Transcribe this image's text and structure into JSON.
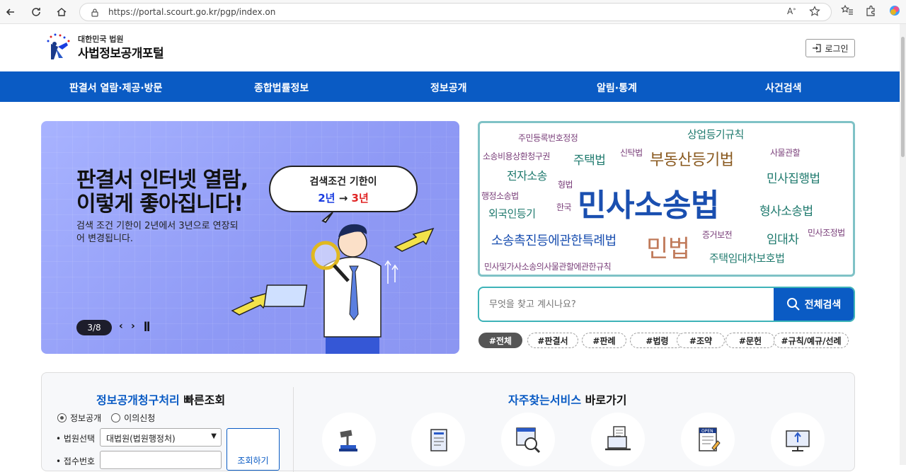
{
  "browser": {
    "url": "https://portal.scourt.go.kr/pgp/index.on"
  },
  "header": {
    "logo_sub": "대한민국 법원",
    "logo_main": "사법정보공개포털",
    "login_label": "로그인"
  },
  "gnb": {
    "items": [
      "판결서 열람·제공·방문",
      "종합법률정보",
      "정보공개",
      "알림·통계",
      "사건검색"
    ]
  },
  "banner": {
    "title_line1": "판결서 인터넷 열람,",
    "title_line2": "이렇게 좋아집니다!",
    "description": "검색 조건 기한이 2년에서 3년으로 연장되어 변경됩니다.",
    "bubble_title": "검색조건 기한이",
    "bubble_old": "2년",
    "bubble_arrow": "→",
    "bubble_new": "3년",
    "counter": "3/8"
  },
  "word_cloud": {
    "words": [
      {
        "text": "주민등록번호정정",
        "color": "#7a3f7a"
      },
      {
        "text": "상업등기규칙",
        "color": "#1f7a6e"
      },
      {
        "text": "소송비용상환청구권",
        "color": "#7a3f7a"
      },
      {
        "text": "주택법",
        "color": "#1f7a6e"
      },
      {
        "text": "신탁법",
        "color": "#7a3f7a"
      },
      {
        "text": "부동산등기법",
        "color": "#8a5a20"
      },
      {
        "text": "사물관할",
        "color": "#7a3f7a"
      },
      {
        "text": "전자소송",
        "color": "#1f7a6e"
      },
      {
        "text": "민사집행법",
        "color": "#1f7a6e"
      },
      {
        "text": "행정소송법",
        "color": "#7a3f7a"
      },
      {
        "text": "형법",
        "color": "#7a3f7a"
      },
      {
        "text": "민사소송법",
        "color": "#1a4fb0"
      },
      {
        "text": "외국인등기",
        "color": "#1f7a6e"
      },
      {
        "text": "한국",
        "color": "#7a3f7a"
      },
      {
        "text": "형사소송법",
        "color": "#1f7a6e"
      },
      {
        "text": "소송촉진등에관한특례법",
        "color": "#1a4fb0"
      },
      {
        "text": "민법",
        "color": "#c07a5a"
      },
      {
        "text": "증거보전",
        "color": "#7a3f7a"
      },
      {
        "text": "임대차",
        "color": "#1f7a6e"
      },
      {
        "text": "민사조정법",
        "color": "#7a3f7a"
      },
      {
        "text": "주택임대차보호법",
        "color": "#1f7a6e"
      },
      {
        "text": "민사및가사소송의사물관할에관한규칙",
        "color": "#7a3f7a"
      }
    ]
  },
  "search": {
    "placeholder": "무엇을 찾고 계시나요?",
    "button_label": "전체검색"
  },
  "chips": [
    "#전체",
    "#판결서",
    "#판례",
    "#법령",
    "#조약",
    "#문헌",
    "#규칙/예규/선례"
  ],
  "quick_lookup": {
    "title_highlight": "정보공개청구처리",
    "title_rest": " 빠른조회",
    "radio_options": [
      "정보공개",
      "이의신청"
    ],
    "court_label": "법원선택",
    "court_value": "대법원(법원행정처)",
    "receipt_label": "접수번호",
    "lookup_button": "조회하기"
  },
  "services": {
    "title_highlight": "자주찾는서비스",
    "title_rest": " 바로가기",
    "icons": [
      "gavel-icon",
      "document-icon",
      "search-document-icon",
      "laptop-icon",
      "open-data-icon",
      "monitor-upload-icon"
    ]
  }
}
